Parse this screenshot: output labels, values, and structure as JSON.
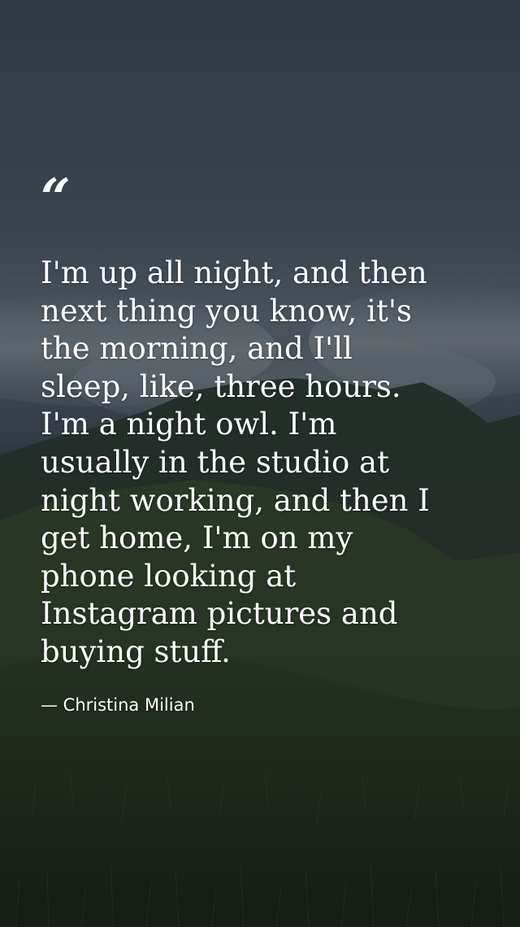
{
  "quote": {
    "mark": "“",
    "text": "I'm up all night, and then\nnext thing you know, it's\nthe morning, and I'll\nsleep, like, three hours.\nI'm a night owl. I'm\nusually in the studio at\nnight working, and then I\nget home, I'm on my\nphone looking at\nInstagram pictures and\nbuying stuff.",
    "author": "— Christina Milian"
  },
  "colors": {
    "text": "#ffffff",
    "sky": "#46535f",
    "hills": "#2c3a2a"
  }
}
